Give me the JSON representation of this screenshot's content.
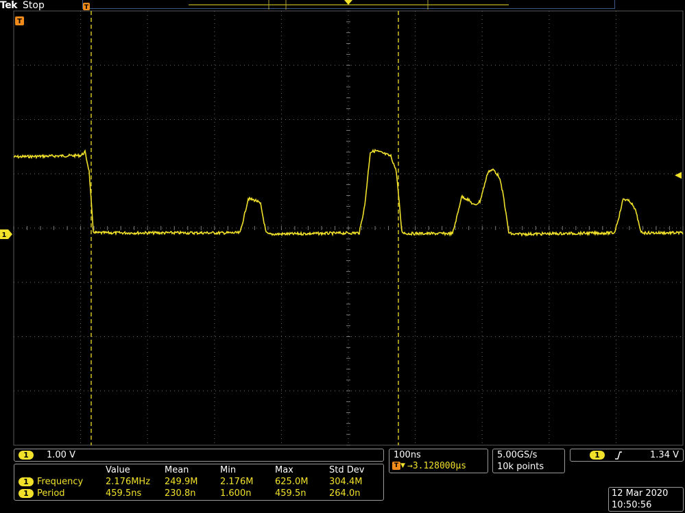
{
  "header": {
    "brand": "Tek",
    "status": "Stop"
  },
  "markers": {
    "trigger_pos": "T",
    "trigger_level": "T",
    "channel": "1"
  },
  "channel": {
    "label": "1",
    "scale": "1.00 V",
    "color": "#f1e12a"
  },
  "horizontal": {
    "time_per_div": "100ns",
    "trigger_marker": "T",
    "position": "→3.128000µs"
  },
  "acquisition": {
    "sample_rate": "5.00GS/s",
    "record_length": "10k points"
  },
  "trigger": {
    "source": "1",
    "slope_icon": "rising-edge-icon",
    "level": "1.34 V"
  },
  "measurements": {
    "columns": [
      "Value",
      "Mean",
      "Min",
      "Max",
      "Std Dev"
    ],
    "rows": [
      {
        "source": "1",
        "name": "Frequency",
        "value": "2.176MHz",
        "mean": "249.9M",
        "min": "2.176M",
        "max": "625.0M",
        "std_dev": "304.4M"
      },
      {
        "source": "1",
        "name": "Period",
        "value": "459.5ns",
        "mean": "230.8n",
        "min": "1.600n",
        "max": "459.5n",
        "std_dev": "264.0n"
      }
    ]
  },
  "datetime": {
    "date": "12 Mar 2020",
    "time": "10:50:56"
  },
  "colors": {
    "trace": "#f1e12a",
    "grid": "#6a6a6a",
    "background": "#000000"
  }
}
